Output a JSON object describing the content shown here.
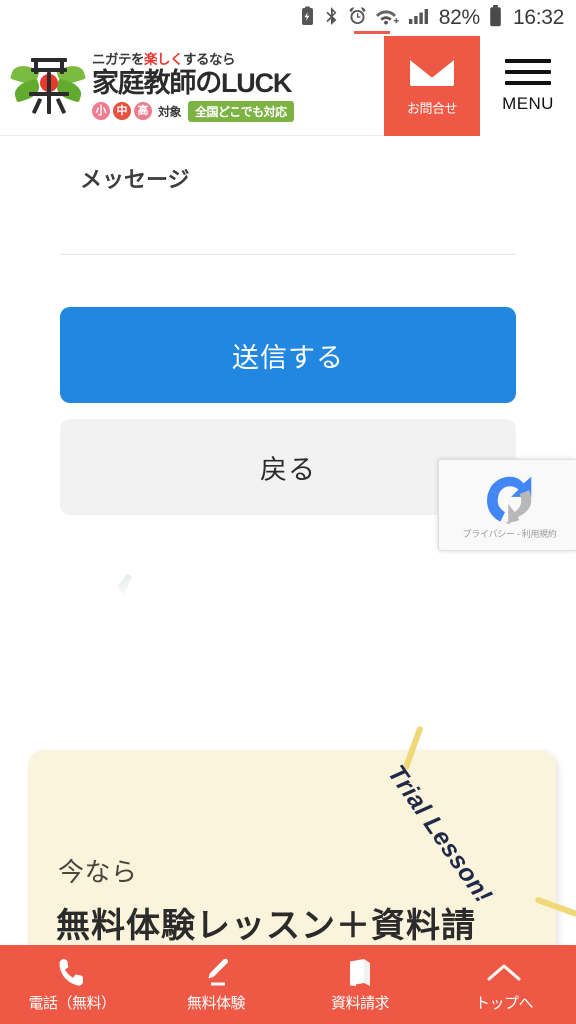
{
  "statusbar": {
    "icons": [
      "battery-saver-icon",
      "bluetooth-icon",
      "alarm-clock-icon",
      "wifi-icon",
      "signal-bars-icon"
    ],
    "battery_percent": "82%",
    "time": "16:32"
  },
  "header": {
    "logo": {
      "tagline_prefix": "ニガテを",
      "tagline_highlight": "楽しく",
      "tagline_suffix": "するなら",
      "brand": "家庭教師のLUCK",
      "badges": [
        "小",
        "中",
        "高"
      ],
      "badge_suffix": "対象",
      "pill": "全国どこでも対応"
    },
    "contact": {
      "label": "お問合せ",
      "icon": "envelope-icon"
    },
    "menu": {
      "label": "MENU",
      "icon": "hamburger-icon"
    }
  },
  "form": {
    "message_field": {
      "label": "メッセージ",
      "value": ""
    },
    "submit_label": "送信する",
    "back_label": "戻る"
  },
  "recaptcha": {
    "icon": "recaptcha-icon",
    "text": "プライバシー - 利用規約"
  },
  "promo": {
    "eyebrow": "今なら",
    "headline": "無料体験レッスン＋資料請",
    "ribbon": "Trial Lesson!"
  },
  "bottomnav": {
    "items": [
      {
        "label": "電話（無料）",
        "icon": "phone-icon"
      },
      {
        "label": "無料体験",
        "icon": "pencil-icon"
      },
      {
        "label": "資料請求",
        "icon": "book-icon"
      },
      {
        "label": "トップへ",
        "icon": "chevron-up-icon"
      }
    ]
  },
  "colors": {
    "accent_orange": "#ee5844",
    "submit_blue": "#2187e0",
    "promo_cream": "#fbf4dd",
    "pill_green": "#7cb342",
    "back_gray": "#f2f2f2"
  }
}
